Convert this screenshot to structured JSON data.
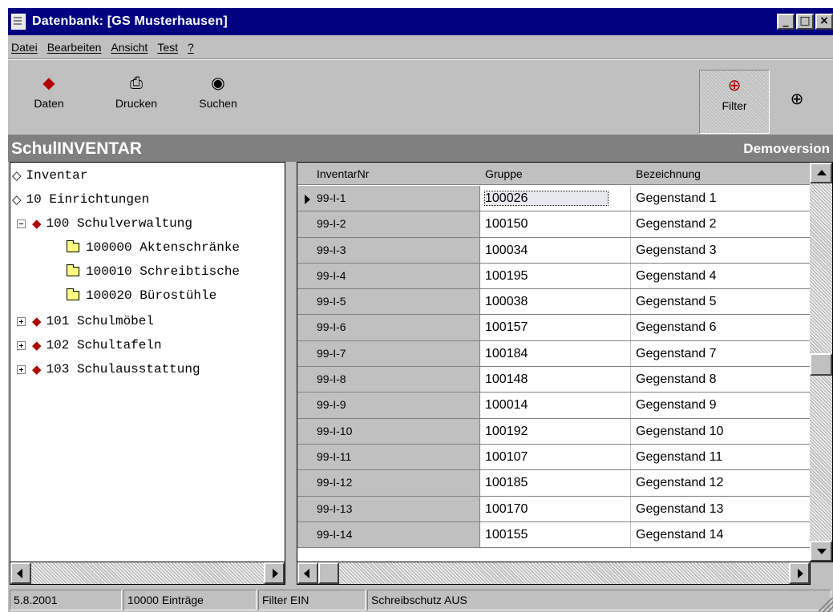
{
  "window": {
    "title": "Datenbank: [GS Musterhausen]",
    "controls": {
      "minimize": "_",
      "maximize": "□",
      "close": "×"
    }
  },
  "menu": [
    "Datei",
    "Bearbeiten",
    "Ansicht",
    "Test",
    "?"
  ],
  "toolbar": {
    "daten": "Daten",
    "drucken": "Drucken",
    "suchen": "Suchen",
    "filter": "Filter"
  },
  "header": {
    "app_name": "SchulINVENTAR",
    "edition": "Demoversion"
  },
  "tree": [
    {
      "label": "Inventar",
      "icon": "book-icon",
      "level": 0
    },
    {
      "label": "10 Einrichtungen",
      "icon": "book-icon",
      "level": 0
    },
    {
      "label": "100 Schulverwaltung",
      "icon": "stack-icon",
      "level": 1,
      "expander": "minus"
    },
    {
      "label": "100000 Aktenschränke",
      "icon": "folder-icon",
      "level": 2
    },
    {
      "label": "100010 Schreibtische",
      "icon": "folder-icon",
      "level": 2
    },
    {
      "label": "100020 Bürostühle",
      "icon": "folder-icon",
      "level": 2
    },
    {
      "label": "101 Schulmöbel",
      "icon": "stack-icon",
      "level": 1,
      "expander": "plus"
    },
    {
      "label": "102 Schultafeln",
      "icon": "stack-icon",
      "level": 1,
      "expander": "plus"
    },
    {
      "label": "103 Schulausstattung",
      "icon": "stack-icon",
      "level": 1,
      "expander": "plus"
    }
  ],
  "grid": {
    "columns": [
      "InventarNr",
      "Gruppe",
      "Bezeichnung"
    ],
    "rows": [
      [
        "99-I-1",
        "100026",
        "Gegenstand 1"
      ],
      [
        "99-I-2",
        "100150",
        "Gegenstand 2"
      ],
      [
        "99-I-3",
        "100034",
        "Gegenstand 3"
      ],
      [
        "99-I-4",
        "100195",
        "Gegenstand 4"
      ],
      [
        "99-I-5",
        "100038",
        "Gegenstand 5"
      ],
      [
        "99-I-6",
        "100157",
        "Gegenstand 6"
      ],
      [
        "99-I-7",
        "100184",
        "Gegenstand 7"
      ],
      [
        "99-I-8",
        "100148",
        "Gegenstand 8"
      ],
      [
        "99-I-9",
        "100014",
        "Gegenstand 9"
      ],
      [
        "99-I-10",
        "100192",
        "Gegenstand 10"
      ],
      [
        "99-I-11",
        "100107",
        "Gegenstand 11"
      ],
      [
        "99-I-12",
        "100185",
        "Gegenstand 12"
      ],
      [
        "99-I-13",
        "100170",
        "Gegenstand 13"
      ],
      [
        "99-I-14",
        "100155",
        "Gegenstand 14"
      ]
    ]
  },
  "status": {
    "date": "5.8.2001",
    "entries": "10000 Einträge",
    "filter": "Filter EIN",
    "write_protect": "Schreibschutz AUS"
  },
  "colors": {
    "titlebar": "#000080",
    "face": "#c0c0c0",
    "header_band": "#808080"
  }
}
